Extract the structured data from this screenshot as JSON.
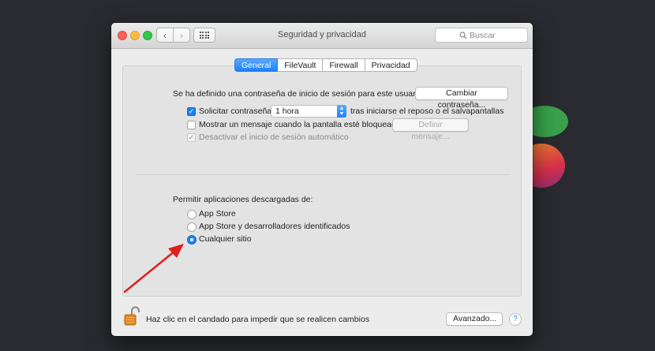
{
  "window": {
    "title": "Seguridad y privacidad",
    "search_placeholder": "Buscar"
  },
  "tabs": [
    {
      "label": "General",
      "active": true
    },
    {
      "label": "FileVault",
      "active": false
    },
    {
      "label": "Firewall",
      "active": false
    },
    {
      "label": "Privacidad",
      "active": false
    }
  ],
  "general": {
    "password_set_text": "Se ha definido una contraseña de inicio de sesión para este usuario",
    "change_password_button": "Cambiar contraseña...",
    "require_password": {
      "label": "Solicitar contraseña",
      "checked": true
    },
    "require_password_delay": "1 hora",
    "require_password_suffix": "tras iniciarse el reposo o el salvapantallas",
    "show_message": {
      "label": "Mostrar un mensaje cuando la pantalla esté bloqueada",
      "checked": false
    },
    "set_message_button": "Definir mensaje...",
    "disable_autologin": {
      "label": "Desactivar el inicio de sesión automático",
      "checked": true,
      "enabled": false
    }
  },
  "downloads": {
    "heading": "Permitir aplicaciones descargadas de:",
    "options": [
      {
        "label": "App Store",
        "selected": false
      },
      {
        "label": "App Store y desarrolladores identificados",
        "selected": false
      },
      {
        "label": "Cualquier sitio",
        "selected": true
      }
    ]
  },
  "footer": {
    "lock_text": "Haz clic en el candado para impedir que se realicen cambios",
    "advanced_button": "Avanzado...",
    "help_label": "?"
  },
  "colors": {
    "accent": "#1a82fb",
    "annotation_arrow": "#e02020",
    "lock": "#e08a1e"
  }
}
